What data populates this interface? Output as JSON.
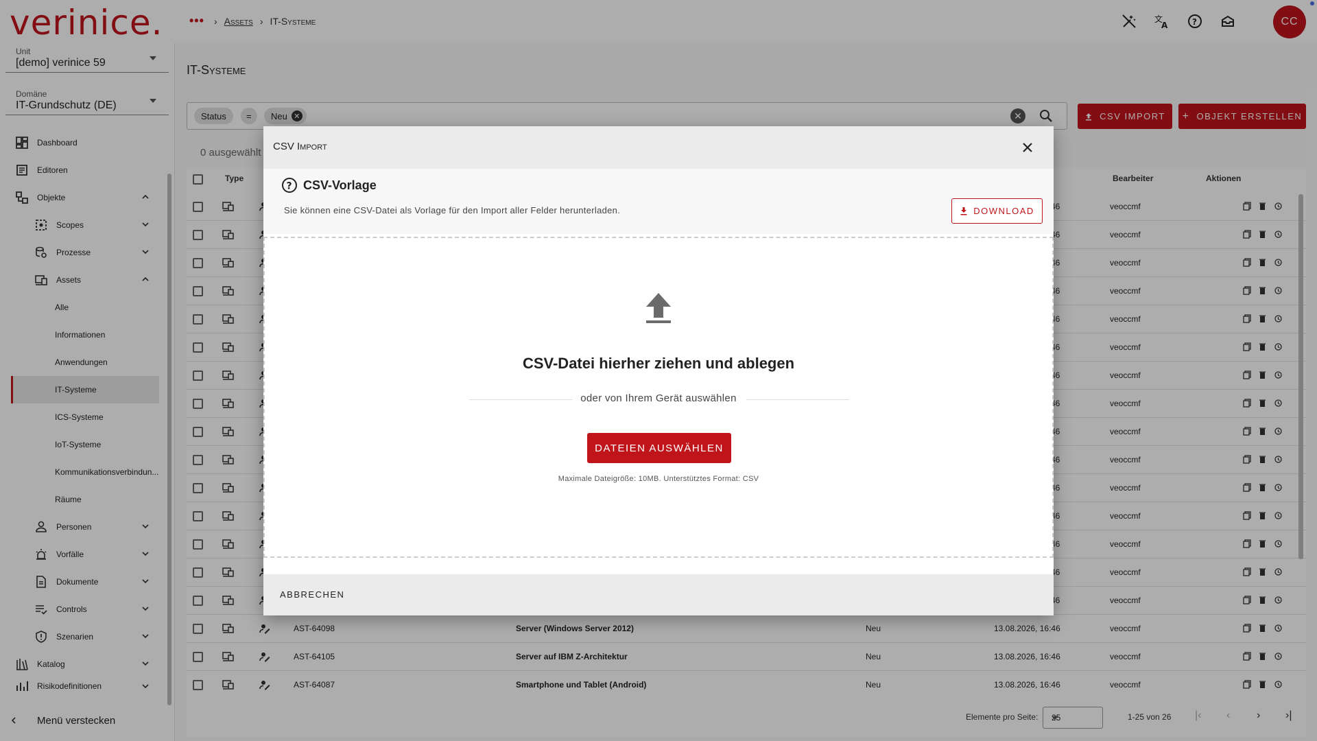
{
  "header": {
    "logo": "verinice",
    "logo_dot": ".",
    "more_label": "•••",
    "breadcrumb": [
      "Assets",
      "IT-Systeme"
    ],
    "avatar_initials": "CC"
  },
  "sidebar": {
    "unit_label": "Unit",
    "unit_value": "[demo] verinice 59",
    "domain_label": "Domäne",
    "domain_value": "IT-Grundschutz (DE)",
    "items": [
      {
        "label": "Dashboard",
        "icon": "dashboard-icon"
      },
      {
        "label": "Editoren",
        "icon": "editor-icon"
      },
      {
        "label": "Objekte",
        "icon": "objects-icon"
      },
      {
        "label": "Scopes",
        "icon": "scope-icon"
      },
      {
        "label": "Prozesse",
        "icon": "process-icon"
      },
      {
        "label": "Assets",
        "icon": "asset-icon"
      },
      {
        "label": "Alle"
      },
      {
        "label": "Informationen"
      },
      {
        "label": "Anwendungen"
      },
      {
        "label": "IT-Systeme"
      },
      {
        "label": "ICS-Systeme"
      },
      {
        "label": "IoT-Systeme"
      },
      {
        "label": "Kommunikationsverbindun..."
      },
      {
        "label": "Räume"
      },
      {
        "label": "Personen",
        "icon": "person-icon"
      },
      {
        "label": "Vorfälle",
        "icon": "incident-icon"
      },
      {
        "label": "Dokumente",
        "icon": "document-icon"
      },
      {
        "label": "Controls",
        "icon": "controls-icon"
      },
      {
        "label": "Szenarien",
        "icon": "scenario-icon"
      },
      {
        "label": "Katalog",
        "icon": "catalog-icon"
      },
      {
        "label": "Risikodefinitionen",
        "icon": "risk-icon"
      }
    ],
    "hide_menu": "Menü verstecken"
  },
  "main": {
    "title": "IT-Systeme",
    "filter": {
      "field": "Status",
      "op": "=",
      "value": "Neu"
    },
    "csv_import_label": "CSV IMPORT",
    "create_label": "OBJEKT ERSTELLEN",
    "selected_count": "0 ausgewählt",
    "columns": {
      "type": "Type",
      "editor": "Bearbeiter",
      "actions": "Aktionen"
    },
    "partial_date": "46",
    "rows": [
      {
        "editor": "veoccmf"
      },
      {
        "editor": "veoccmf"
      },
      {
        "editor": "veoccmf"
      },
      {
        "editor": "veoccmf"
      },
      {
        "editor": "veoccmf"
      },
      {
        "editor": "veoccmf"
      },
      {
        "editor": "veoccmf"
      },
      {
        "editor": "veoccmf"
      },
      {
        "editor": "veoccmf"
      },
      {
        "editor": "veoccmf"
      },
      {
        "editor": "veoccmf"
      },
      {
        "editor": "veoccmf"
      },
      {
        "editor": "veoccmf"
      },
      {
        "editor": "veoccmf"
      },
      {
        "editor": "veoccmf"
      }
    ],
    "visible_rows": [
      {
        "id": "AST-64098",
        "name": "Server (Windows Server 2012)",
        "status": "Neu",
        "date": "13.08.2026, 16:46",
        "editor": "veoccmf"
      },
      {
        "id": "AST-64105",
        "name": "Server auf IBM Z-Architektur",
        "status": "Neu",
        "date": "13.08.2026, 16:46",
        "editor": "veoccmf"
      },
      {
        "id": "AST-64087",
        "name": "Smartphone und Tablet (Android)",
        "status": "Neu",
        "date": "13.08.2026, 16:46",
        "editor": "veoccmf"
      }
    ],
    "pager": {
      "per_page_label": "Elemente pro Seite:",
      "per_page_value": "25",
      "range": "1-25 von 26"
    }
  },
  "dialog": {
    "title": "CSV Import",
    "template_title": "CSV-Vorlage",
    "template_desc": "Sie können eine CSV-Datei als Vorlage für den Import aller Felder herunterladen.",
    "download_label": "DOWNLOAD",
    "drop_title": "CSV-Datei hierher ziehen und ablegen",
    "or_text": "oder von Ihrem Gerät auswählen",
    "choose_label": "DATEIEN AUSWÄHLEN",
    "max_size": "Maximale Dateigröße: 10MB. Unterstütztes Format: CSV",
    "cancel_label": "ABBRECHEN"
  },
  "colors": {
    "brand": "#c0141b",
    "overlay": "rgba(0,0,0,0.32)"
  }
}
